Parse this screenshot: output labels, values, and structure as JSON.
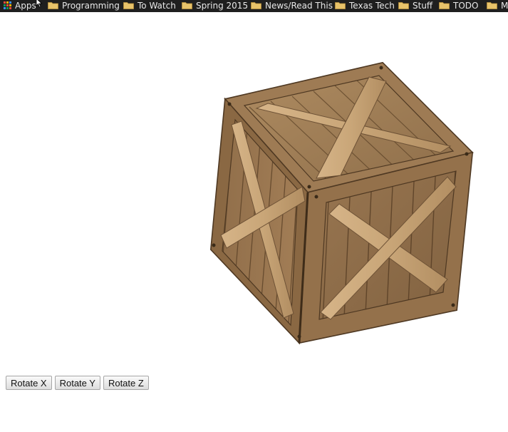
{
  "bookmarks": {
    "apps_label": "Apps",
    "folders": [
      {
        "label": "Programming"
      },
      {
        "label": "To Watch"
      },
      {
        "label": "Spring 2015"
      },
      {
        "label": "News/Read This"
      },
      {
        "label": "Texas Tech"
      },
      {
        "label": "Stuff"
      },
      {
        "label": "TODO"
      },
      {
        "label": "M"
      }
    ]
  },
  "controls": {
    "rotate_x": "Rotate X",
    "rotate_y": "Rotate Y",
    "rotate_z": "Rotate Z"
  },
  "colors": {
    "bar_bg": "#1f1f1f",
    "folder": "#e8c36a",
    "wood_light": "#c8a67a",
    "wood_dark": "#6e5236"
  }
}
